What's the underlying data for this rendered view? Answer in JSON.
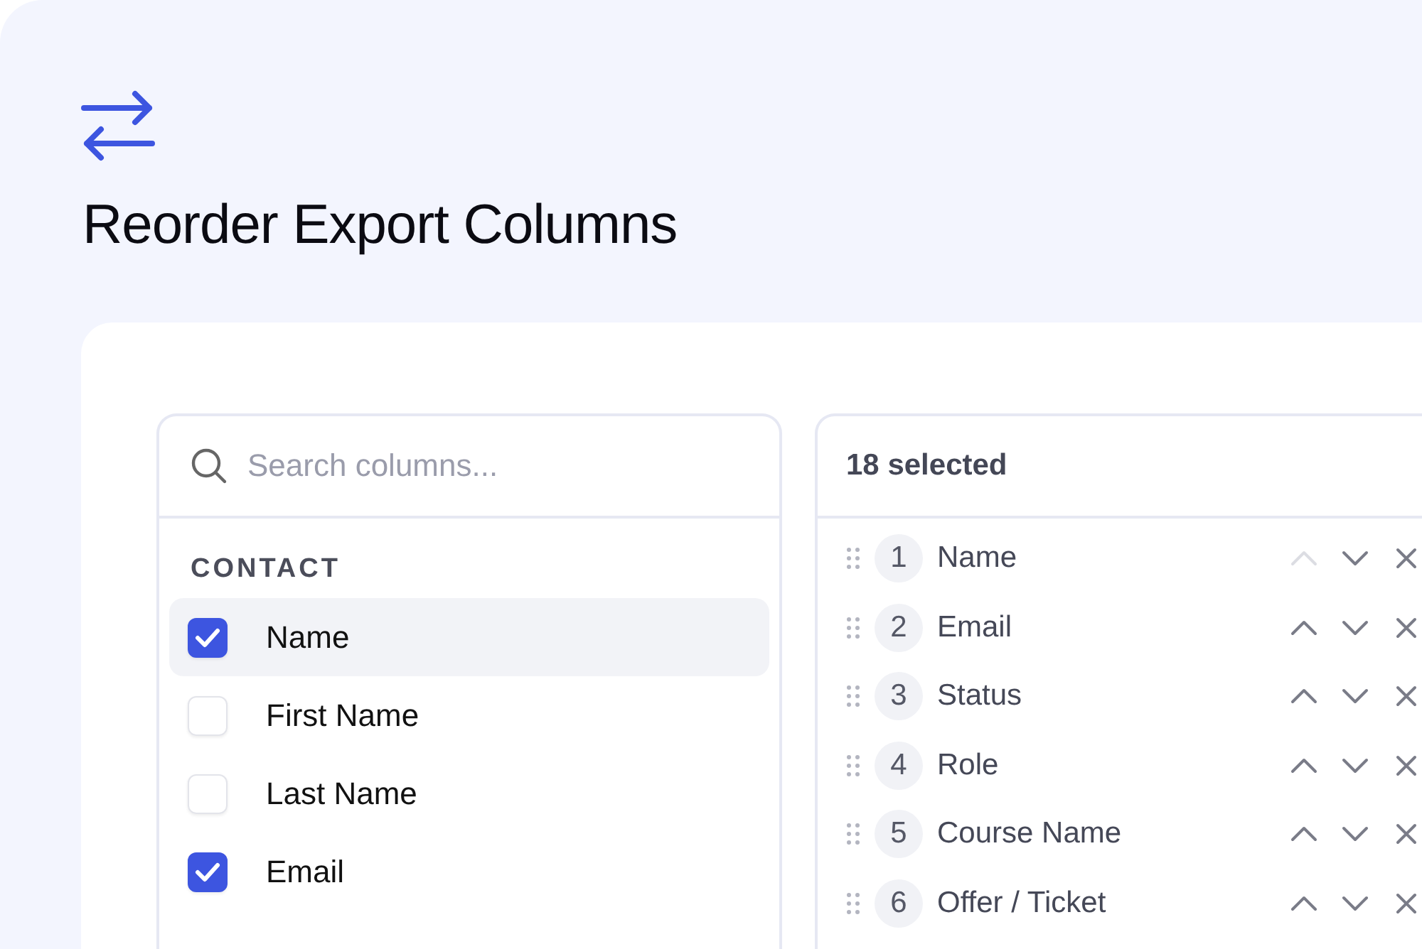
{
  "title": "Reorder Export Columns",
  "available": {
    "search": {
      "placeholder": "Search columns..."
    },
    "group": "CONTACT",
    "items": [
      {
        "label": "Name",
        "checked": true,
        "selected": true
      },
      {
        "label": "First Name",
        "checked": false,
        "selected": false
      },
      {
        "label": "Last Name",
        "checked": false,
        "selected": false
      },
      {
        "label": "Email",
        "checked": true,
        "selected": false
      }
    ]
  },
  "chosen": {
    "count_label": "18 selected",
    "items": [
      {
        "number": "1",
        "label": "Name",
        "up_disabled": true
      },
      {
        "number": "2",
        "label": "Email",
        "up_disabled": false
      },
      {
        "number": "3",
        "label": "Status",
        "up_disabled": false
      },
      {
        "number": "4",
        "label": "Role",
        "up_disabled": false
      },
      {
        "number": "5",
        "label": "Course Name",
        "up_disabled": false
      },
      {
        "number": "6",
        "label": "Offer / Ticket",
        "up_disabled": false
      }
    ]
  }
}
